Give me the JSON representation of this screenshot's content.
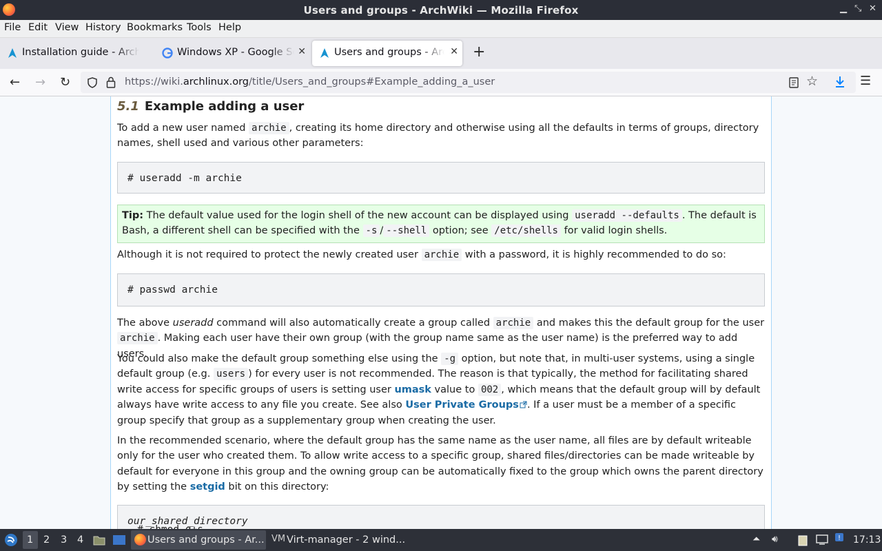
{
  "window": {
    "title": "Users and groups - ArchWiki — Mozilla Firefox"
  },
  "menu": [
    "File",
    "Edit",
    "View",
    "History",
    "Bookmarks",
    "Tools",
    "Help"
  ],
  "tabs": [
    {
      "label": "Installation guide - ArchWiki",
      "icon": "archlinux-icon"
    },
    {
      "label": "Windows XP - Google Search",
      "icon": "google-icon"
    },
    {
      "label": "Users and groups - ArchWiki",
      "icon": "archlinux-icon",
      "active": true
    }
  ],
  "urlbar": {
    "prefix": "https://wiki.",
    "domain": "archlinux.org",
    "path": "/title/Users_and_groups#Example_adding_a_user"
  },
  "article": {
    "section_number": "5.1",
    "section_title": "Example adding a user",
    "p1": {
      "a": "To add a new user named ",
      "code": "archie",
      "b": ", creating its home directory and otherwise using all the defaults in terms of groups, directory names, shell used and various other parameters:"
    },
    "cmd1": "# useradd -m archie",
    "tip": {
      "label": "Tip:",
      "a": " The default value used for the login shell of the new account can be displayed using ",
      "code1": "useradd --defaults",
      "b": ". The default is Bash, a different shell can be specified with the ",
      "code2": "-s",
      "c": "/",
      "code3": "--shell",
      "d": " option; see ",
      "code4": "/etc/shells",
      "e": " for valid login shells."
    },
    "p2": {
      "a": "Although it is not required to protect the newly created user ",
      "code": "archie",
      "b": " with a password, it is highly recommended to do so:"
    },
    "cmd2": "# passwd archie",
    "p3": {
      "a": "The above ",
      "em": "useradd",
      "b": " command will also automatically create a group called ",
      "code1": "archie",
      "c": " and makes this the default group for the user ",
      "code2": "archie",
      "d": ". Making each user have their own group (with the group name same as the user name) is the preferred way to add users."
    },
    "p4": {
      "a": "You could also make the default group something else using the ",
      "code1": "-g",
      "b": " option, but note that, in multi-user systems, using a single default group (e.g. ",
      "code2": "users",
      "c": ") for every user is not recommended. The reason is that typically, the method for facilitating shared write access for specific groups of users is setting user ",
      "link1": "umask",
      "d": " value to ",
      "code3": "002",
      "e": ", which means that the default group will by default always have write access to any file you create. See also ",
      "link2": "User Private Groups",
      "f": ". If a user must be a member of a specific group specify that group as a supplementary group when creating the user."
    },
    "p5": {
      "a": "In the recommended scenario, where the default group has the same name as the user name, all files are by default writeable only for the user who created them. To allow write access to a specific group, shared files/directories can be made writeable by default for everyone in this group and the owning group can be automatically fixed to the group which owns the parent directory by setting the ",
      "link": "setgid",
      "b": " bit on this directory:"
    },
    "cmd3": {
      "a": "# chmod g+s ",
      "em": "our_shared_directory"
    }
  },
  "taskbar": {
    "workspaces": [
      "1",
      "2",
      "3",
      "4"
    ],
    "windows": [
      {
        "label": "Users and groups - Ar...",
        "icon": "firefox-icon",
        "active": true
      },
      {
        "label": "Virt-manager - 2 wind...",
        "icon": "virt-manager-icon"
      }
    ],
    "clock": "17:13"
  },
  "colors": {
    "link": "#1a6ba5",
    "tip_bg": "#e6ffe6",
    "section_number": "#6b5b3e"
  }
}
